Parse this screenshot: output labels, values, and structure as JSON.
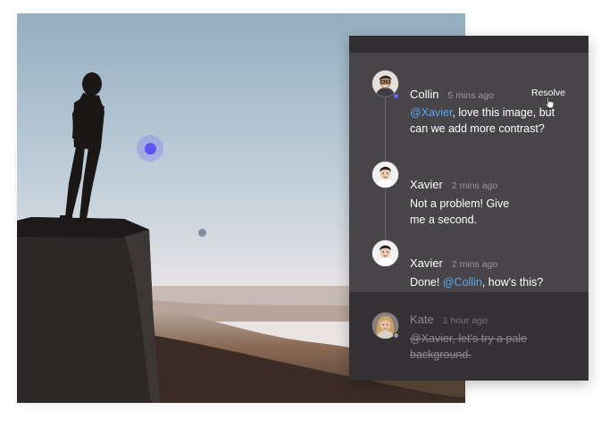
{
  "thread": {
    "comments": [
      {
        "author": "Collin",
        "time": "5 mins ago",
        "mention": "@Xavier",
        "text_after": ", love this image, but can we add more contrast?",
        "action": "Resolve",
        "avatar_icon": "avatar-collin"
      },
      {
        "author": "Xavier",
        "time": "2 mins ago",
        "text": "Not a problem! Give me a second.",
        "avatar_icon": "avatar-xavier"
      },
      {
        "author": "Xavier",
        "time": "2 mins ago",
        "text_before": "Done! ",
        "mention": "@Collin",
        "text_after": ", how's this?",
        "avatar_icon": "avatar-xavier"
      }
    ],
    "resolved": {
      "author": "Kate",
      "time": "1 hour ago",
      "text": "@Xavier, let's try a pale background.",
      "avatar_icon": "avatar-kate"
    }
  },
  "pins": [
    "active-comment-pin",
    "comment-pin"
  ],
  "icons": [
    "pointer-cursor-icon"
  ],
  "colors": {
    "accent": "#5c55f0",
    "mention": "#5aa6f0",
    "panel": "#474548",
    "resolved_bg": "#333134"
  }
}
